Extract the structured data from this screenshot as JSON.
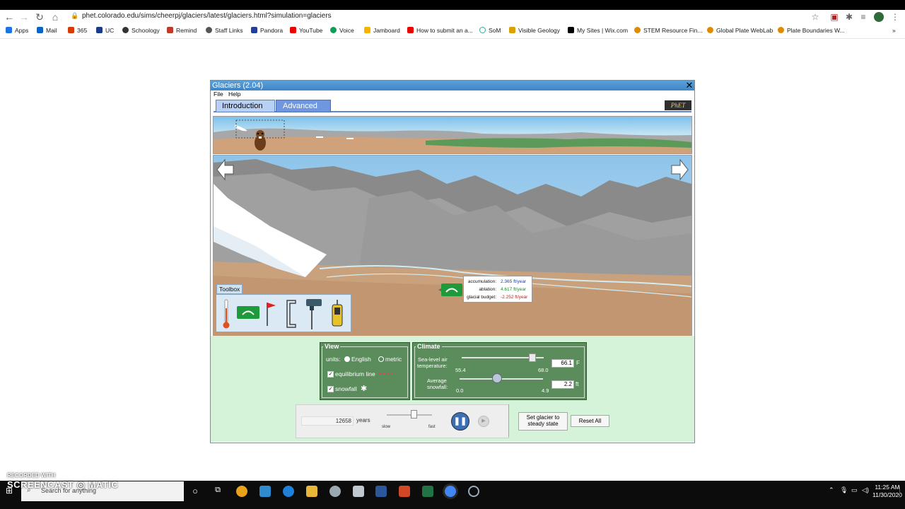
{
  "browser": {
    "url": "phet.colorado.edu/sims/cheerpj/glaciers/latest/glaciers.html?simulation=glaciers",
    "bookmarks": [
      "Apps",
      "Mail",
      "365",
      "UC",
      "Schoology",
      "Remind",
      "Staff Links",
      "Pandora",
      "YouTube",
      "Voice",
      "Jamboard",
      "How to submit an a...",
      "SoM",
      "Visible Geology",
      "My Sites | Wix.com",
      "STEM Resource Fin...",
      "Global Plate WebLab",
      "Plate Boundaries W..."
    ]
  },
  "sim": {
    "title": "Glaciers (2.04)",
    "close": "✕",
    "menu": {
      "file": "File",
      "help": "Help"
    },
    "tabs": {
      "intro": "Introduction",
      "advanced": "Advanced"
    },
    "logo": "PhET",
    "toolbox_label": "Toolbox",
    "readout": {
      "accumulation_label": "accumulation:",
      "accumulation_value": "2.365 ft/year",
      "ablation_label": "ablation:",
      "ablation_value": "4.617 ft/year",
      "budget_label": "glacial budget:",
      "budget_value": "-2.252 ft/year"
    },
    "view": {
      "title": "View",
      "units_label": "units:",
      "english": "English",
      "metric": "metric",
      "units_selected": "English",
      "equilibrium_line": "equilibrium line",
      "equilibrium_checked": true,
      "snowfall": "snowfall",
      "snowfall_checked": true
    },
    "climate": {
      "title": "Climate",
      "temp_label_1": "Sea-level air",
      "temp_label_2": "temperature:",
      "temp_min": "55.4",
      "temp_max": "68.0",
      "temp_value": "66.1",
      "temp_unit": "F",
      "snow_label_1": "Average",
      "snow_label_2": "snowfall:",
      "snow_min": "0.0",
      "snow_max": "4.9",
      "snow_value": "2.2",
      "snow_unit": "ft"
    },
    "clock": {
      "years_value": "12658",
      "years_label": "years",
      "slow": "slow",
      "fast": "fast",
      "speed_fraction": 0.6
    },
    "buttons": {
      "steady_1": "Set glacier to",
      "steady_2": "steady state",
      "reset": "Reset All"
    }
  },
  "taskbar": {
    "search_placeholder": "Search for anything",
    "time": "11:25 AM",
    "date": "11/30/2020"
  },
  "watermark": {
    "line1": "RECORDED WITH",
    "line2": "SCREENCAST ◎ MATIC"
  },
  "colors": {
    "panel_green": "#5b8c5c",
    "control_bg": "#d5f3d8",
    "tab_active": "#b9d0f5",
    "tab_inactive": "#6f97e0"
  }
}
